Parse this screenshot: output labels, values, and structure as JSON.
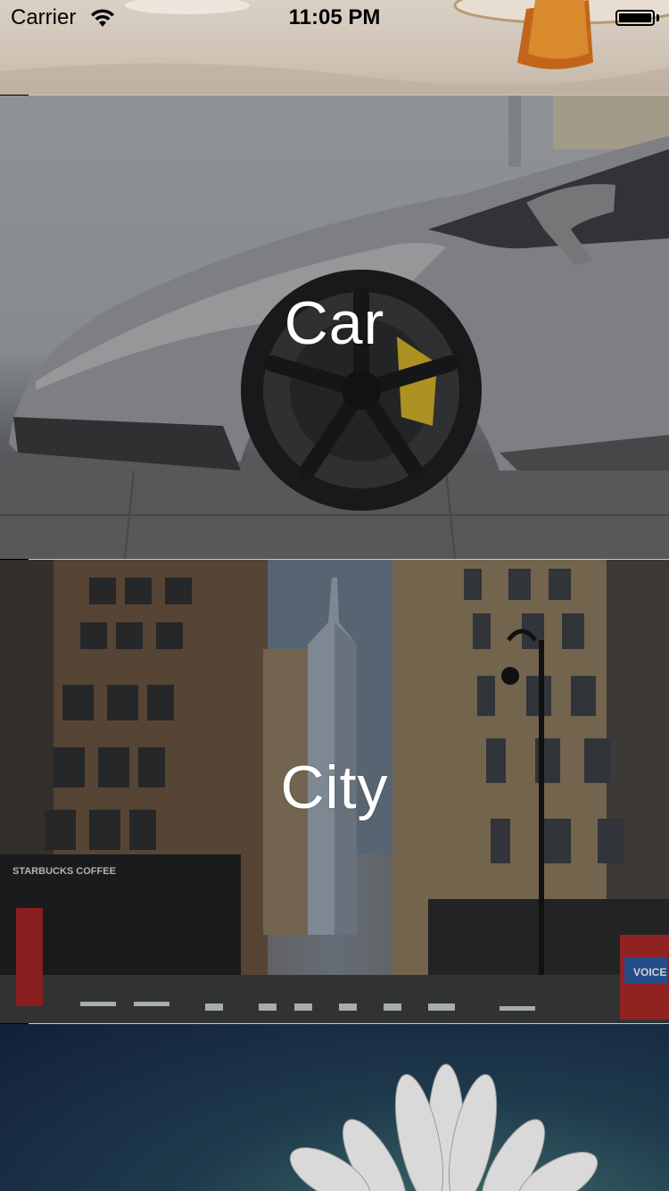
{
  "status_bar": {
    "carrier": "Carrier",
    "time": "11:05 PM",
    "icons": [
      "wifi-icon",
      "battery-icon"
    ]
  },
  "list": {
    "items": [
      {
        "label": "",
        "image": "beach"
      },
      {
        "label": "Car",
        "image": "car"
      },
      {
        "label": "City",
        "image": "city"
      },
      {
        "label": "",
        "image": "flower"
      }
    ]
  },
  "signage": {
    "storefront": "STARBUCKS COFFEE",
    "street_box": "VOICE"
  },
  "colors": {
    "label_text": "#ffffff",
    "separator": "#c8c7cc",
    "status_text": "#000000"
  }
}
